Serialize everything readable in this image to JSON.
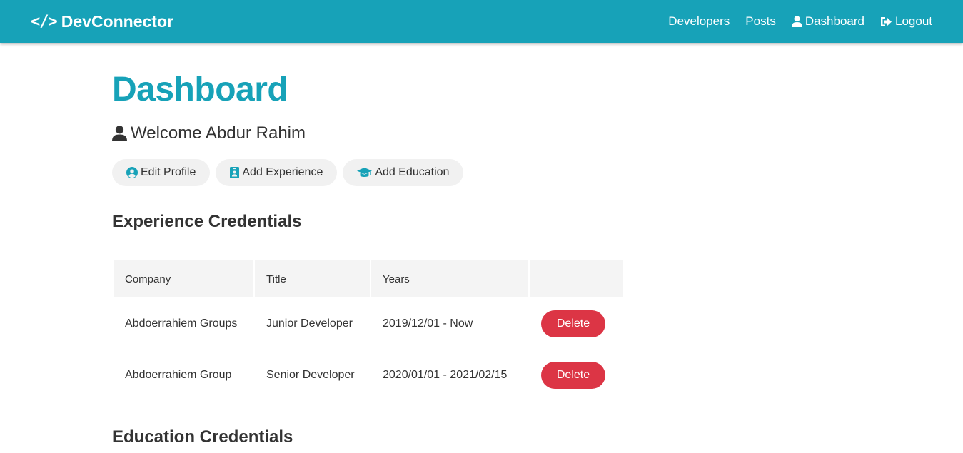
{
  "navbar": {
    "brand_icon": "</>",
    "brand": "DevConnector",
    "links": [
      {
        "label": "Developers",
        "icon": null
      },
      {
        "label": "Posts",
        "icon": null
      },
      {
        "label": "Dashboard",
        "icon": "user-icon"
      },
      {
        "label": "Logout",
        "icon": "sign-out-icon"
      }
    ]
  },
  "page": {
    "title": "Dashboard",
    "welcome": "Welcome Abdur Rahim"
  },
  "actions": {
    "edit_profile": "Edit Profile",
    "add_experience": "Add Experience",
    "add_education": "Add Education"
  },
  "experience": {
    "heading": "Experience Credentials",
    "columns": [
      "Company",
      "Title",
      "Years",
      ""
    ],
    "rows": [
      {
        "company": "Abdoerrahiem Groups",
        "title": "Junior Developer",
        "years": "2019/12/01 - Now",
        "action": "Delete"
      },
      {
        "company": "Abdoerrahiem Group",
        "title": "Senior Developer",
        "years": "2020/01/01 - 2021/02/15",
        "action": "Delete"
      }
    ]
  },
  "education": {
    "heading": "Education Credentials"
  },
  "colors": {
    "primary": "#17a2b8",
    "danger": "#dc3545",
    "light": "#f4f4f4",
    "text": "#333333"
  }
}
